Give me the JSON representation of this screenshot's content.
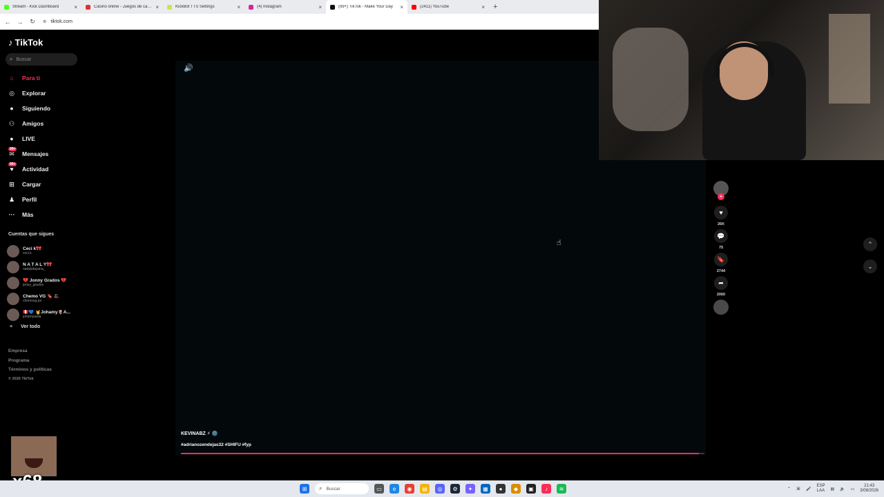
{
  "browser": {
    "tabs": [
      {
        "title": "Stream - Kick Dashboard",
        "color": "#53fc18",
        "active": false
      },
      {
        "title": "Casino online - Juegos de casino",
        "color": "#e0322f",
        "active": false
      },
      {
        "title": "KickBot TTS Settings",
        "color": "#c8e64a",
        "active": false
      },
      {
        "title": "(4) Instagram",
        "color": "#d6249f",
        "active": false
      },
      {
        "title": "(99+) TikTok - Make Your Day",
        "color": "#111111",
        "active": true
      },
      {
        "title": "(2411) YouTube",
        "color": "#ff0000",
        "active": false
      }
    ],
    "new_tab": "+",
    "url": "tiktok.com"
  },
  "sidebar": {
    "logo": "TikTok",
    "search_placeholder": "Buscar",
    "nav": [
      {
        "label": "Para ti",
        "icon": "home-icon",
        "active": true
      },
      {
        "label": "Explorar",
        "icon": "compass-icon",
        "active": false
      },
      {
        "label": "Siguiendo",
        "icon": "following-icon",
        "active": false
      },
      {
        "label": "Amigos",
        "icon": "friends-icon",
        "active": false
      },
      {
        "label": "LIVE",
        "icon": "live-icon",
        "active": false
      },
      {
        "label": "Mensajes",
        "icon": "messages-icon",
        "active": false,
        "badge": "99+"
      },
      {
        "label": "Actividad",
        "icon": "activity-icon",
        "active": false,
        "badge": "99+"
      },
      {
        "label": "Cargar",
        "icon": "upload-icon",
        "active": false
      },
      {
        "label": "Perfil",
        "icon": "profile-icon",
        "active": false
      },
      {
        "label": "Más",
        "icon": "more-icon",
        "active": false
      }
    ],
    "following_title": "Cuentas que sigues",
    "following": [
      {
        "name": "Ceci k🎀",
        "handle": "ceci.k"
      },
      {
        "name": "N A T A L Y🎀",
        "handle": "natalydayana_"
      },
      {
        "name": "💔 Jonny Grados 💔",
        "handle": "jenny_grados"
      },
      {
        "name": "Chemo VG 🔖 🎩",
        "handle": "chemovg.pe"
      },
      {
        "name": "🇵🇪💙 🤘Johamy🌷A...",
        "handle": "johamyavila"
      }
    ],
    "see_all": "Ver todo",
    "footer": [
      "Empresa",
      "Programa",
      "Términos y políticas"
    ],
    "copyright": "© 2026 TikTok"
  },
  "video": {
    "author": "KEVINABZ ⚡ 🌚",
    "hashtags": "#adrianozendejas32 #SHIFU #fyp",
    "progress": 0.99
  },
  "actions": {
    "likes": "26K",
    "comments": "75",
    "saves": "2744",
    "shares": "2060"
  },
  "overlay": {
    "emote_count": "x68"
  },
  "taskbar": {
    "search_placeholder": "Buscar",
    "lang_line1": "ESP",
    "lang_line2": "LAA",
    "time": "21:43",
    "date": "3/08/2026"
  }
}
